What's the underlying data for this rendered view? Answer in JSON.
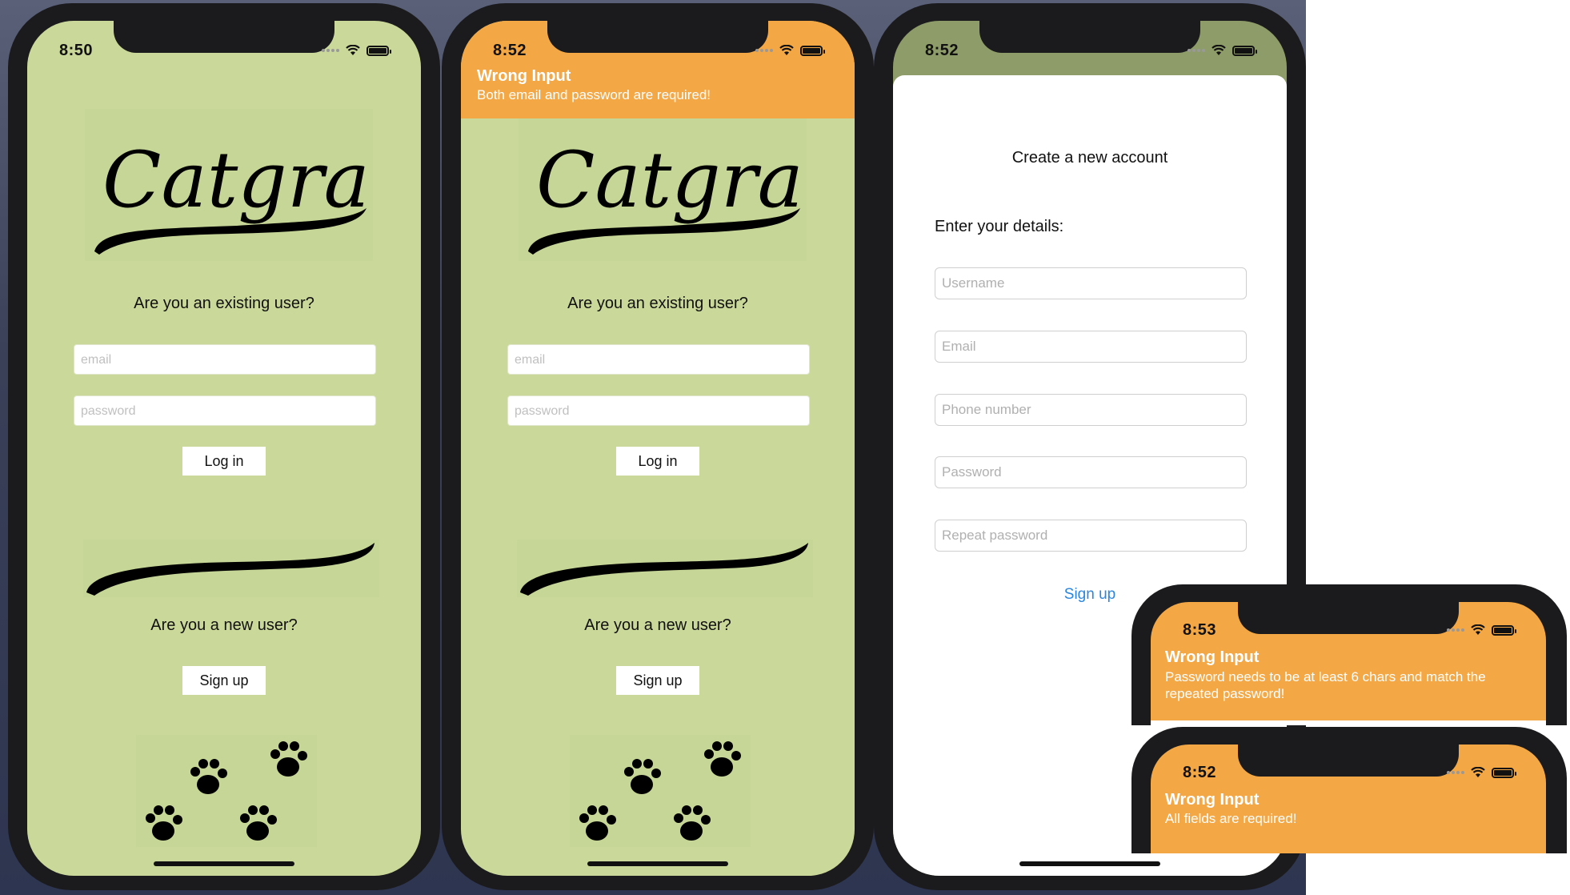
{
  "screen1": {
    "time": "8:50",
    "existing_question": "Are you an existing user?",
    "email_placeholder": "email",
    "password_placeholder": "password",
    "login_label": "Log in",
    "new_question": "Are you a new user?",
    "signup_label": "Sign up",
    "logo_text": "Catgram"
  },
  "screen2": {
    "time": "8:52",
    "banner_title": "Wrong Input",
    "banner_message": "Both email and password are required!",
    "existing_question": "Are you an existing user?",
    "email_placeholder": "email",
    "password_placeholder": "password",
    "login_label": "Log in",
    "new_question": "Are you a new user?",
    "signup_label": "Sign up",
    "logo_text": "Catgram"
  },
  "screen3": {
    "time": "8:52",
    "title": "Create a new account",
    "subtitle": "Enter your details:",
    "fields": [
      "Username",
      "Email",
      "Phone number",
      "Password",
      "Repeat password"
    ],
    "signup_label": "Sign up"
  },
  "alert1": {
    "time": "8:53",
    "title": "Wrong Input",
    "message": "Password needs to be at least 6 chars and match the repeated password!"
  },
  "alert2": {
    "time": "8:52",
    "title": "Wrong Input",
    "message": "All fields are required!"
  },
  "colors": {
    "screen_bg": "#cad99a",
    "alert_orange": "#f4a845",
    "link_blue": "#2a86e0",
    "phone_frame": "#1b1b1d"
  }
}
